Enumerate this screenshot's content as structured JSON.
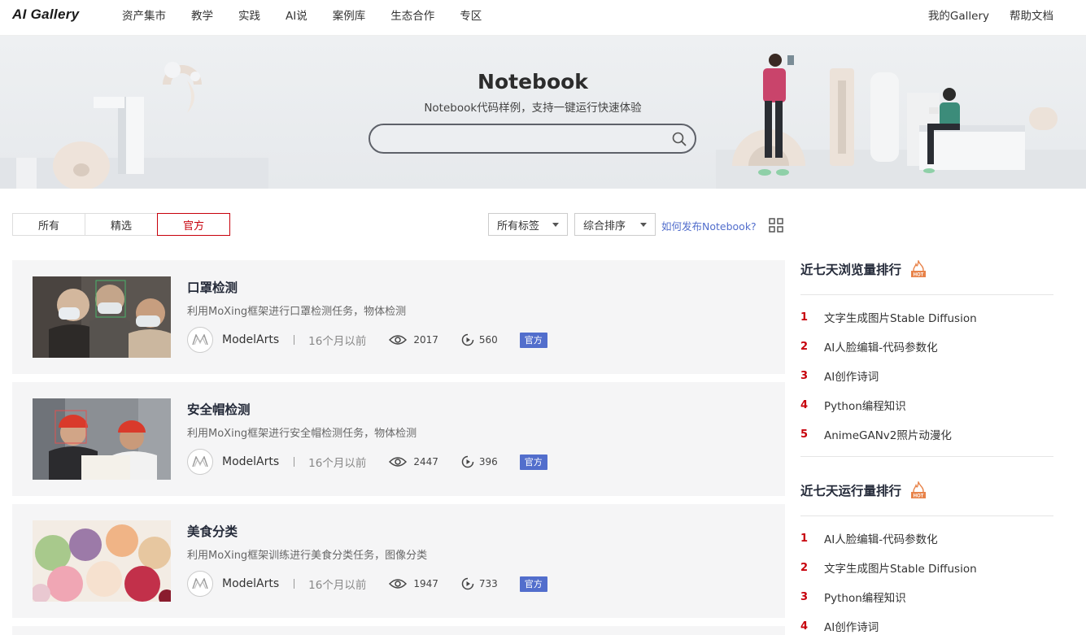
{
  "app": {
    "logo": "AI Gallery"
  },
  "nav": {
    "links": [
      "资产集市",
      "教学",
      "实践",
      "AI说",
      "案例库",
      "生态合作",
      "专区"
    ],
    "right": [
      "我的Gallery",
      "帮助文档"
    ]
  },
  "banner": {
    "title": "Notebook",
    "subtitle": "Notebook代码样例，支持一键运行快速体验",
    "search_placeholder": ""
  },
  "filters": {
    "tabs": [
      "所有",
      "精选",
      "官方"
    ],
    "active_tab": "官方",
    "tag_dropdown": "所有标签",
    "sort_dropdown": "综合排序",
    "publish_link": "如何发布Notebook?"
  },
  "cards": [
    {
      "title": "口罩检测",
      "desc": "利用MoXing框架进行口罩检测任务，物体检测",
      "author": "ModelArts",
      "time": "16个月以前",
      "views": "2017",
      "runs": "560",
      "badge": "官方"
    },
    {
      "title": "安全帽检测",
      "desc": "利用MoXing框架进行安全帽检测任务，物体检测",
      "author": "ModelArts",
      "time": "16个月以前",
      "views": "2447",
      "runs": "396",
      "badge": "官方"
    },
    {
      "title": "美食分类",
      "desc": "利用MoXing框架训练进行美食分类任务，图像分类",
      "author": "ModelArts",
      "time": "16个月以前",
      "views": "1947",
      "runs": "733",
      "badge": "官方"
    }
  ],
  "sidebar": {
    "views_title": "近七天浏览量排行",
    "views_ranking": [
      {
        "rank": "1",
        "name": "文字生成图片Stable Diffusion"
      },
      {
        "rank": "2",
        "name": "AI人脸编辑-代码参数化"
      },
      {
        "rank": "3",
        "name": "AI创作诗词"
      },
      {
        "rank": "4",
        "name": "Python编程知识"
      },
      {
        "rank": "5",
        "name": "AnimeGANv2照片动漫化"
      }
    ],
    "runs_title": "近七天运行量排行",
    "runs_ranking": [
      {
        "rank": "1",
        "name": "AI人脸编辑-代码参数化"
      },
      {
        "rank": "2",
        "name": "文字生成图片Stable Diffusion"
      },
      {
        "rank": "3",
        "name": "Python编程知识"
      },
      {
        "rank": "4",
        "name": "AI创作诗词"
      }
    ]
  },
  "colors": {
    "accent_red": "#c7000b",
    "badge_blue": "#526ecc",
    "card_bg": "#f5f5f6"
  }
}
